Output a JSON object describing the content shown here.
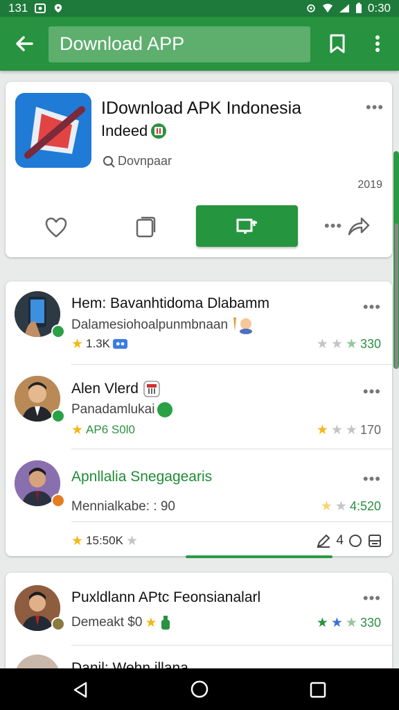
{
  "status_bar": {
    "time_left": "131",
    "time_right": "0:30"
  },
  "app_bar": {
    "search_text": "Download APP"
  },
  "featured": {
    "title": "IDownload APK Indonesia",
    "developer": "Indeed",
    "meta": "Dovnpaar",
    "year": "2019",
    "more": "•••",
    "overflow": "•••"
  },
  "list": [
    {
      "title": "Hem: Bavanhtidoma Dlabamm",
      "subtitle": "Dalamesiohoalpunmbnaan",
      "meta": "1.3K",
      "rating": "330",
      "more": "•••",
      "title_green": false
    },
    {
      "title": "Alen Vlerd",
      "subtitle": "Panadamlukai",
      "meta": "AP6 S0l0",
      "rating": "170",
      "more": "•••",
      "title_green": false
    },
    {
      "title": "Apnllalia Snegagearis",
      "subtitle": "Mennialkabe: : 90",
      "meta": "15:50K",
      "rating": "4:520",
      "more": "•••",
      "title_green": true,
      "tools_text": "4"
    }
  ],
  "list2": [
    {
      "title": "Puxldlann APtc Feonsianalarl",
      "subtitle": "Demeakt $0",
      "rating": "330",
      "more": "•••"
    },
    {
      "title": "Danil: Wehn illana"
    }
  ],
  "colors": {
    "primary": "#27923f",
    "primary_dark": "#1e7a3a",
    "accent_green": "#26953f",
    "star_gold": "#f2b817"
  }
}
